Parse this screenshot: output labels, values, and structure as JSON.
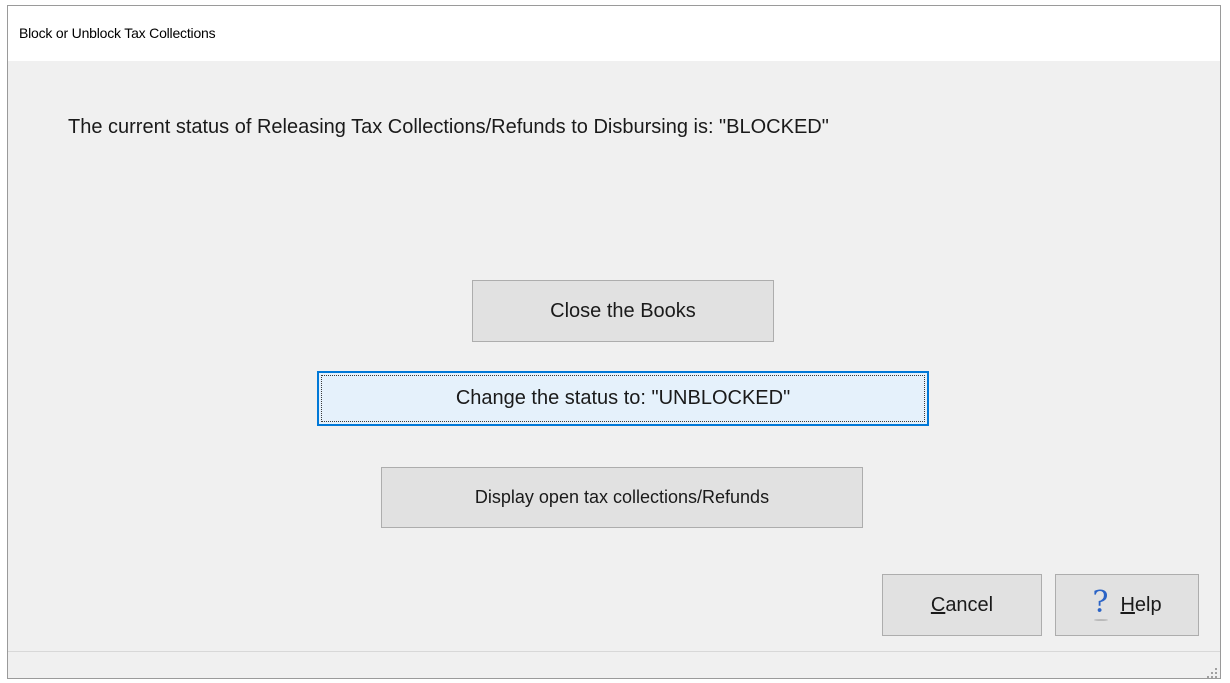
{
  "window": {
    "title": "Block or Unblock Tax Collections"
  },
  "main": {
    "status_message": "The current status of Releasing Tax Collections/Refunds to Disbursing is: \"BLOCKED\""
  },
  "buttons": {
    "close_books": "Close the Books",
    "change_status": "Change the status to: \"UNBLOCKED\"",
    "display_open": "Display open tax collections/Refunds",
    "cancel_mnemonic": "C",
    "cancel_rest": "ancel",
    "help_mnemonic": "H",
    "help_rest": "elp",
    "help_icon": "question-mark-icon"
  },
  "colors": {
    "window_bg": "#f0f0f0",
    "focus_border": "#0078d7",
    "help_icon": "#2a63c6"
  }
}
